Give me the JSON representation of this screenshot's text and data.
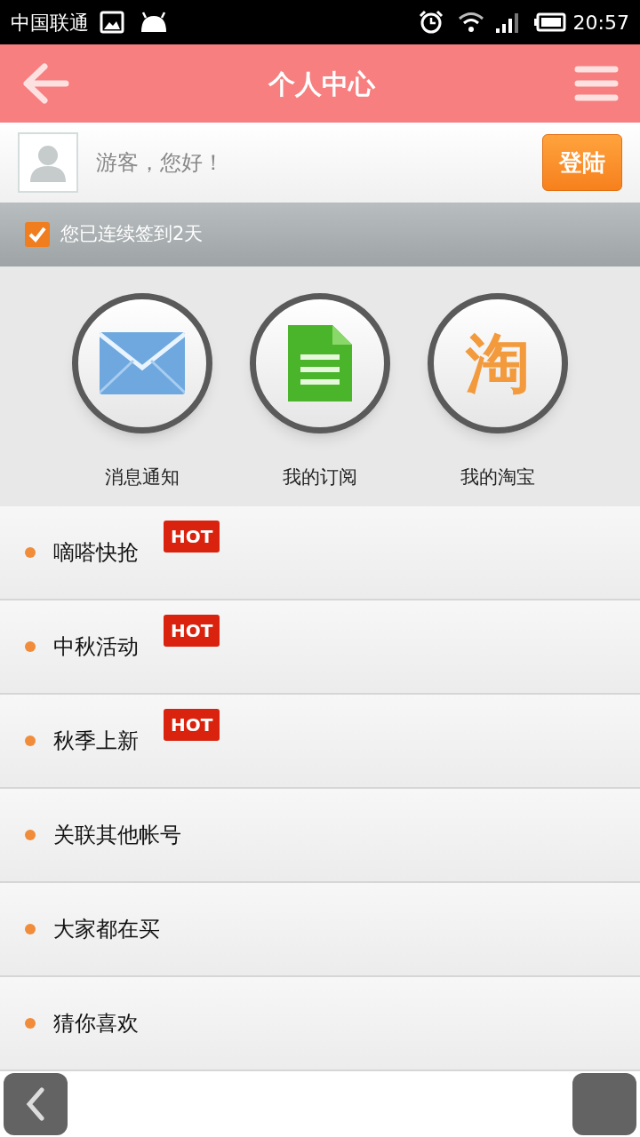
{
  "status_bar": {
    "carrier": "中国联通",
    "time": "20:57"
  },
  "header": {
    "title": "个人中心"
  },
  "user": {
    "greeting": "游客，您好！",
    "login_button": "登陆"
  },
  "checkin": {
    "checked": true,
    "label": "您已连续签到2天"
  },
  "shortcuts": [
    {
      "kind": "mail",
      "label": "消息通知"
    },
    {
      "kind": "document",
      "label": "我的订阅"
    },
    {
      "kind": "glyph",
      "glyph": "淘",
      "label": "我的淘宝"
    }
  ],
  "menu": [
    {
      "label": "嘀嗒快抢",
      "badge": "HOT"
    },
    {
      "label": "中秋活动",
      "badge": "HOT"
    },
    {
      "label": "秋季上新",
      "badge": "HOT"
    },
    {
      "label": "关联其他帐号"
    },
    {
      "label": "大家都在买"
    },
    {
      "label": "猜你喜欢"
    }
  ]
}
